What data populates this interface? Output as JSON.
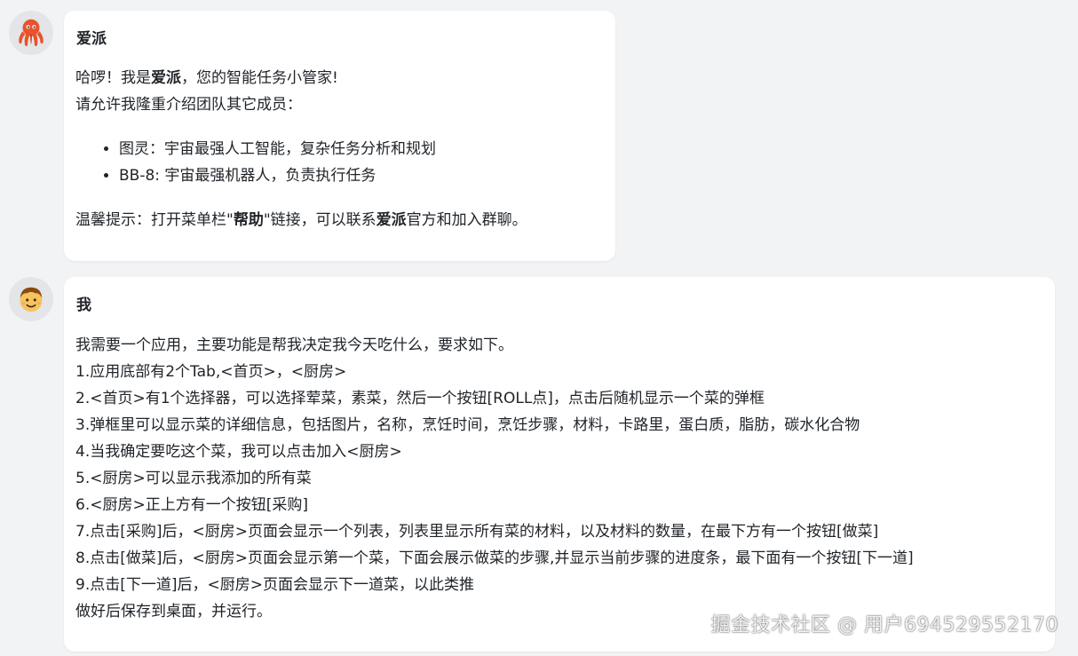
{
  "bot_message": {
    "sender": "爱派",
    "greeting_pre": "哈啰！我是",
    "greeting_name": "爱派",
    "greeting_post": "，您的智能任务小管家!",
    "intro": "请允许我隆重介绍团队其它成员：",
    "members": [
      "图灵：宇宙最强人工智能，复杂任务分析和规划",
      "BB-8: 宇宙最强机器人，负责执行任务"
    ],
    "tip_pre": "温馨提示：打开菜单栏\"",
    "tip_help": "帮助",
    "tip_mid": "\"链接，可以联系",
    "tip_name": "爱派",
    "tip_post": "官方和加入群聊。"
  },
  "user_message": {
    "sender": "我",
    "lines": [
      "我需要一个应用，主要功能是帮我决定我今天吃什么，要求如下。",
      "1.应用底部有2个Tab,<首页>，<厨房>",
      "2.<首页>有1个选择器，可以选择荤菜，素菜，然后一个按钮[ROLL点]，点击后随机显示一个菜的弹框",
      "3.弹框里可以显示菜的详细信息，包括图片，名称，烹饪时间，烹饪步骤，材料，卡路里，蛋白质，脂肪，碳水化合物",
      "4.当我确定要吃这个菜，我可以点击加入<厨房>",
      "5.<厨房>可以显示我添加的所有菜",
      "6.<厨房>正上方有一个按钮[采购]",
      "7.点击[采购]后，<厨房>页面会显示一个列表，列表里显示所有菜的材料，以及材料的数量，在最下方有一个按钮[做菜]",
      "8.点击[做菜]后，<厨房>页面会显示第一个菜，下面会展示做菜的步骤,并显示当前步骤的进度条，最下面有一个按钮[下一道]",
      "9.点击[下一道]后，<厨房>页面会显示下一道菜，以此类推",
      "做好后保存到桌面，并运行。"
    ]
  },
  "watermark": "掘金技术社区 @ 用户694529552170",
  "colors": {
    "page_bg": "#f2f3f5",
    "bubble_bg": "#ffffff",
    "avatar_bg": "#e3e5e8",
    "octopus": "#e8532b",
    "user_face": "#f7c35f",
    "user_hair": "#8a4b12"
  },
  "icons": {
    "bot_avatar": "octopus-icon",
    "user_avatar": "user-face-icon"
  }
}
